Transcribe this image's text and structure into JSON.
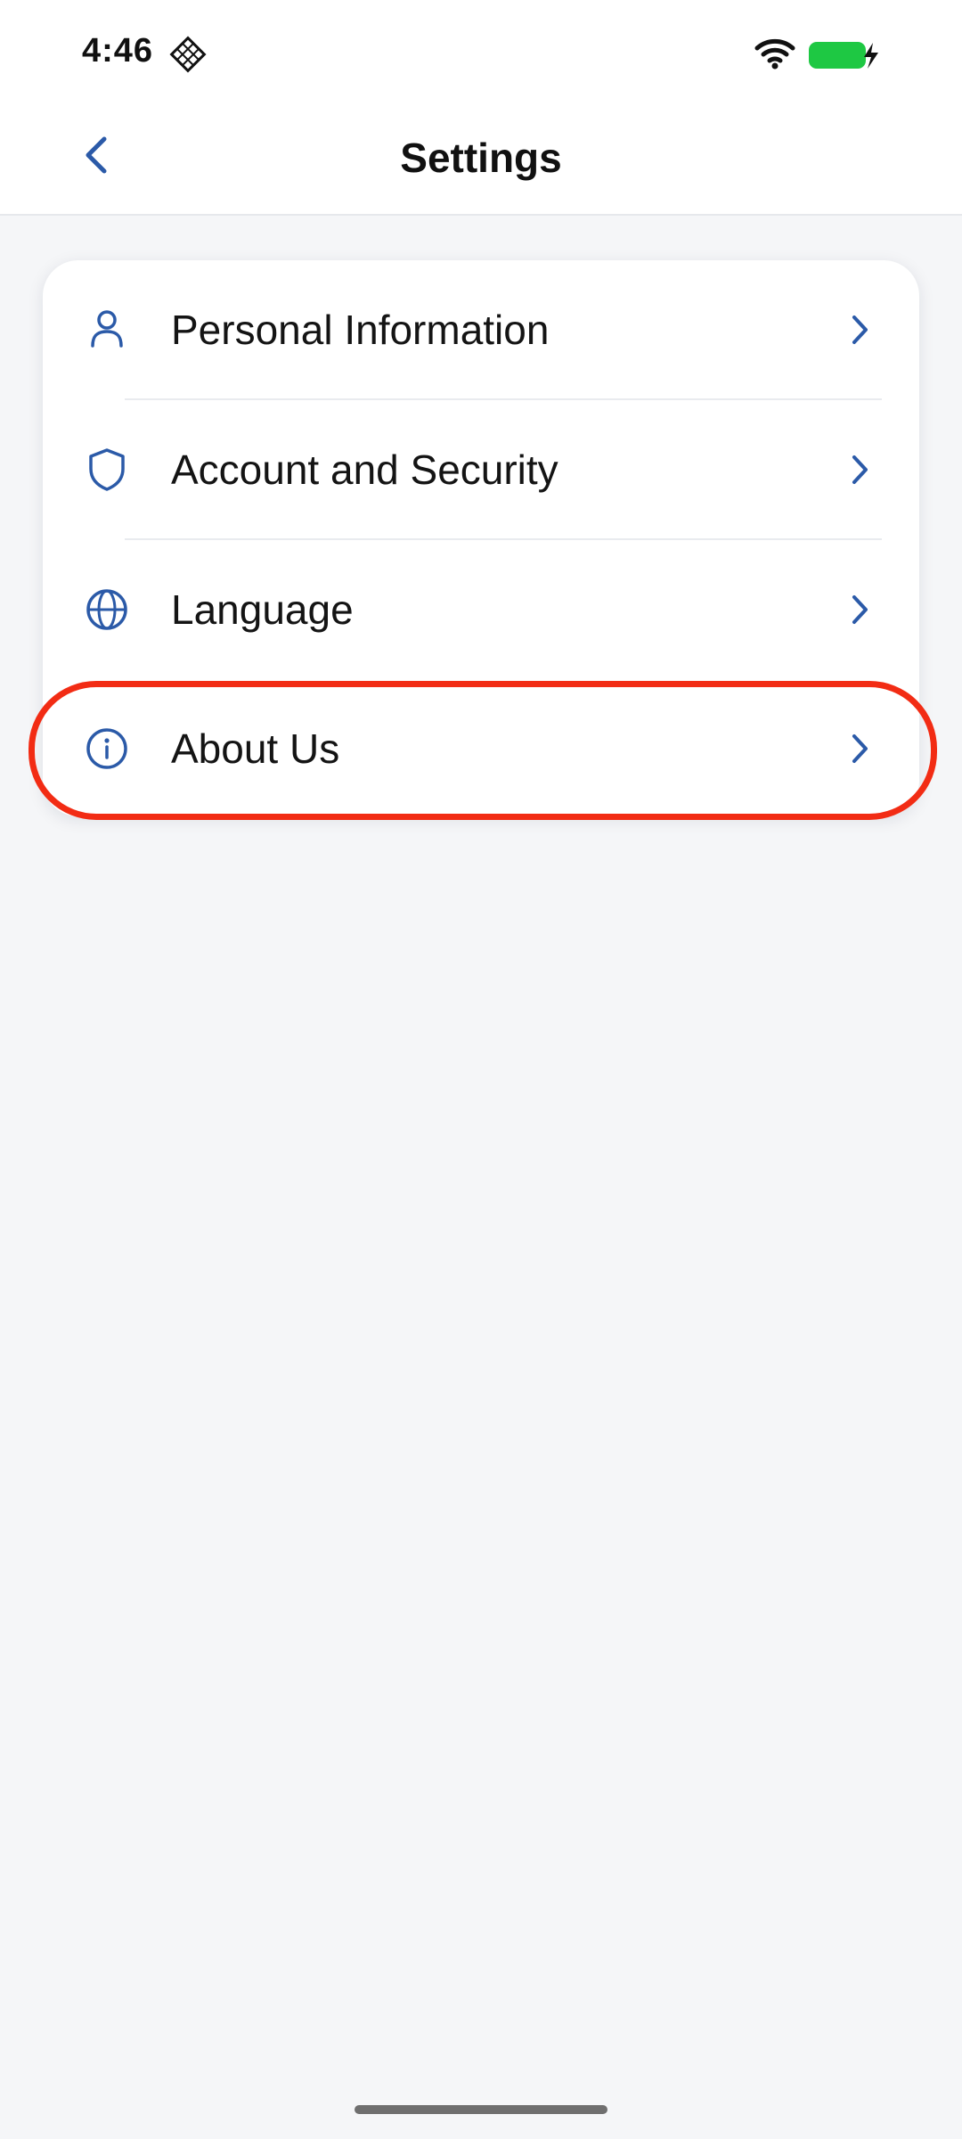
{
  "status_bar": {
    "time": "4:46",
    "app_icon": "diamond-grid-icon",
    "wifi_icon": "wifi-icon",
    "battery_icon": "battery-charging-icon",
    "battery_color": "#1ec843"
  },
  "header": {
    "back_icon": "chevron-left-icon",
    "title": "Settings"
  },
  "settings": {
    "items": [
      {
        "label": "Personal Information",
        "icon": "user-icon"
      },
      {
        "label": "Account and Security",
        "icon": "shield-icon"
      },
      {
        "label": "Language",
        "icon": "globe-icon"
      },
      {
        "label": "About Us",
        "icon": "info-icon"
      }
    ],
    "chevron_icon": "chevron-right-icon"
  },
  "colors": {
    "accent": "#2b5aa8",
    "highlight": "#f22c14",
    "background": "#f5f6f8"
  }
}
